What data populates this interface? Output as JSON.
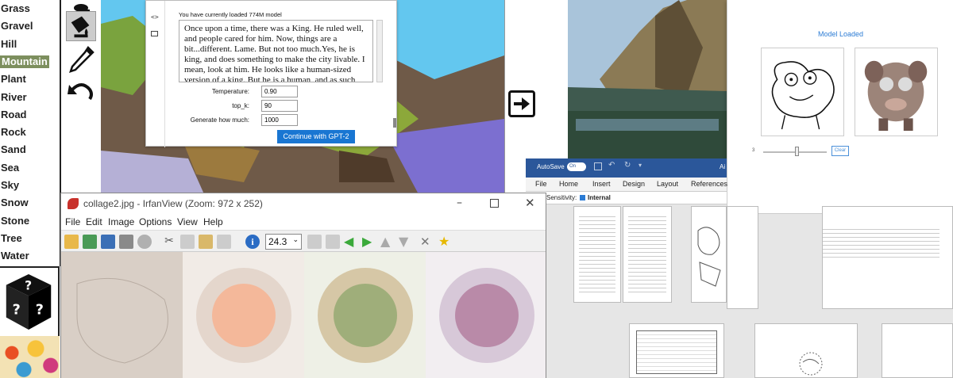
{
  "terrain_labels": [
    "Grass",
    "Gravel",
    "Hill",
    "Mountain",
    "Plant",
    "River",
    "Road",
    "Rock",
    "Sand",
    "Sea",
    "Sky",
    "Snow",
    "Stone",
    "Tree",
    "Water"
  ],
  "selected_label": "Mountain",
  "gpt": {
    "status": "You have currently loaded 774M model",
    "text": "Once upon a time, there was a King. He ruled well, and people cared for him. Now, things are a bit...different. Lame. But not too much.Yes, he is king, and does something to make the city livable. I mean, look at him. He looks like a human-sized version of a king. But he is a human, and as such, has two legs. He's built more like a robot than a king.Yes, I know, I know, he is a robot-king, and this makes sense, he is, after all. It is a",
    "temperature_label": "Temperature:",
    "temperature_value": "0.90",
    "topk_label": "top_k:",
    "topk_value": "90",
    "length_label": "Generate how much:",
    "length_value": "1000",
    "button": "Continue with GPT-2"
  },
  "model_panel": {
    "title": "Model Loaded",
    "slider_value": "3",
    "clear": "Clear"
  },
  "word": {
    "autosave": "AutoSave",
    "toggle": "On",
    "title_fragment": "Ai",
    "tabs": [
      "File",
      "Home",
      "Insert",
      "Design",
      "Layout",
      "References"
    ],
    "sensitivity_label": "Sensitivity:",
    "sensitivity_value": "Internal"
  },
  "irfan": {
    "title": "collage2.jpg - IrfanView (Zoom: 972 x 252)",
    "menu": [
      "File",
      "Edit",
      "Image",
      "Options",
      "View",
      "Help"
    ],
    "zoom": "24.3"
  },
  "colors": {
    "accent_blue": "#1976d2",
    "word_blue": "#2b579a",
    "selected_label_bg": "#7d8f5e"
  }
}
